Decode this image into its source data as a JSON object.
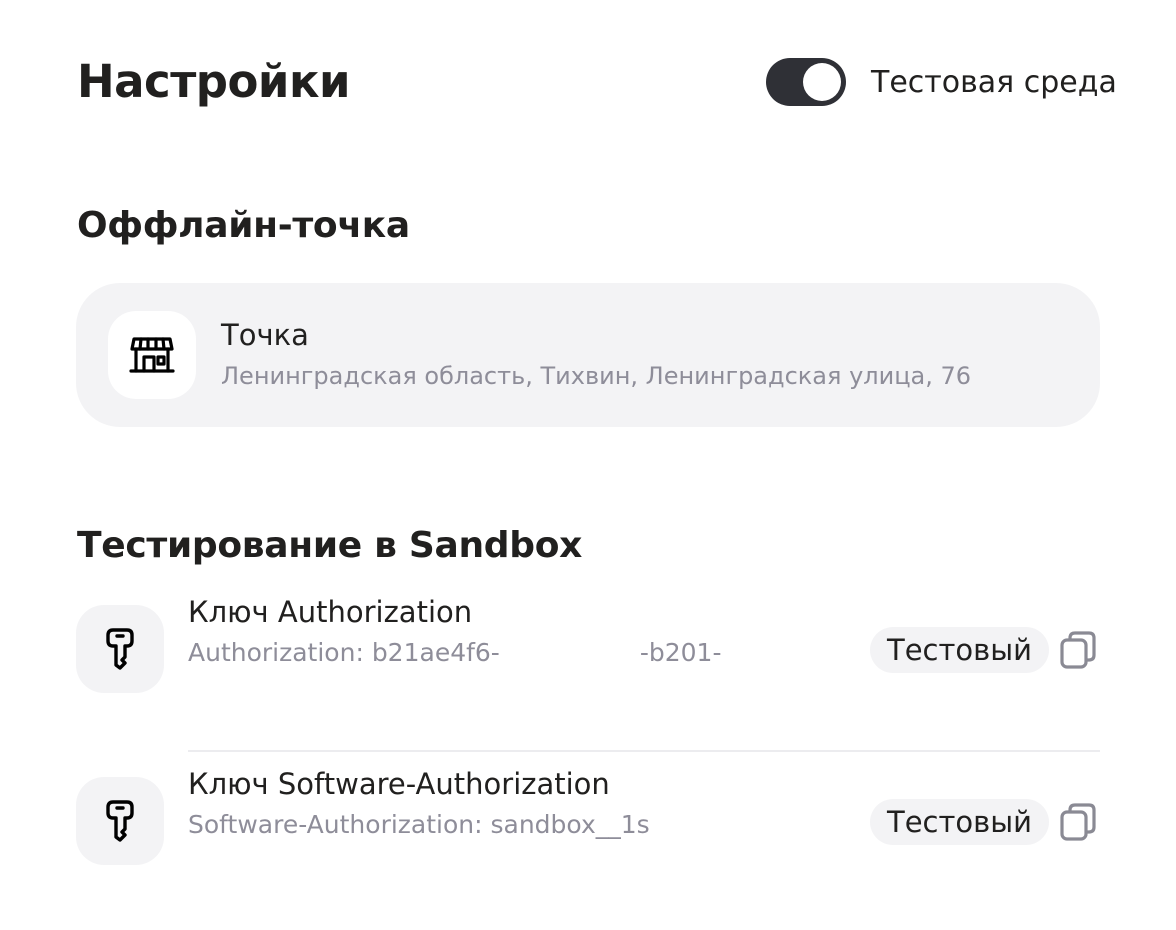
{
  "header": {
    "title": "Настройки",
    "toggle": {
      "label": "Тестовая среда",
      "state": "on"
    }
  },
  "offline_section": {
    "title": "Оффлайн-точка",
    "point": {
      "icon": "store-icon",
      "name": "Точка",
      "address": "Ленинградская область, Тихвин, Ленинградская улица, 76"
    }
  },
  "sandbox_section": {
    "title": "Тестирование в Sandbox",
    "keys": [
      {
        "icon": "key-icon",
        "title": "Ключ Authorization",
        "value_start": "Authorization: b21ae4f6-",
        "value_end": "-b201-",
        "badge": "Тестовый",
        "copy_icon": "copy-icon"
      },
      {
        "icon": "key-icon",
        "title": "Ключ Software-Authorization",
        "value_start": "Software-Authorization: sandbox__1s",
        "badge": "Тестовый",
        "copy_icon": "copy-icon"
      }
    ]
  },
  "colors": {
    "text_primary": "#21201f",
    "text_secondary": "#8e8d99",
    "card_background": "#f3f3f5",
    "toggle_on": "#2f3036"
  }
}
